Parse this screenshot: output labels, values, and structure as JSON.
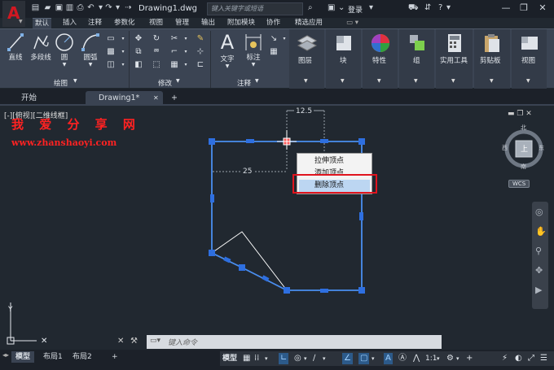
{
  "titlebar": {
    "app_letter": "A",
    "document_title": "Drawing1.dwg",
    "search_placeholder": "键入关键字或短语",
    "login_label": "登录"
  },
  "ribbon_tabs": [
    {
      "label": "默认",
      "active": true
    },
    {
      "label": "插入"
    },
    {
      "label": "注释"
    },
    {
      "label": "参数化"
    },
    {
      "label": "视图"
    },
    {
      "label": "管理"
    },
    {
      "label": "输出"
    },
    {
      "label": "附加模块"
    },
    {
      "label": "协作"
    },
    {
      "label": "精选应用"
    }
  ],
  "ribbon": {
    "draw": {
      "line": "直线",
      "polyline": "多段线",
      "circle": "圆",
      "arc": "圆弧",
      "group_label": "绘图"
    },
    "modify": {
      "group_label": "修改"
    },
    "annotation": {
      "text": "文字",
      "dimension": "标注",
      "group_label": "注释"
    },
    "layers": "图层",
    "block": "块",
    "properties": "特性",
    "groups": "组",
    "utilities": "实用工具",
    "clipboard": "剪贴板",
    "view": "视图"
  },
  "file_tabs": {
    "start": "开始",
    "drawing": "Drawing1*",
    "add": "+"
  },
  "viewport": {
    "label": "[-][俯视][二维线框]",
    "watermark_title": "我 爱 分 享 网",
    "watermark_url": "www.zhanshaoyi.com",
    "dim_top": "12.5",
    "dim_left": "25"
  },
  "context_menu": {
    "items": [
      {
        "label": "拉伸顶点"
      },
      {
        "label": "添加顶点"
      },
      {
        "label": "删除顶点",
        "highlighted": true
      }
    ]
  },
  "viewcube": {
    "north": "北",
    "south": "南",
    "east": "东",
    "west": "西",
    "top": "上",
    "wcs": "WCS"
  },
  "command_line": {
    "placeholder": "键入命令"
  },
  "layout_tabs": [
    {
      "label": "模型",
      "active": true
    },
    {
      "label": "布局1"
    },
    {
      "label": "布局2"
    }
  ],
  "statusbar": {
    "model_label": "模型",
    "scale": "1:1"
  }
}
